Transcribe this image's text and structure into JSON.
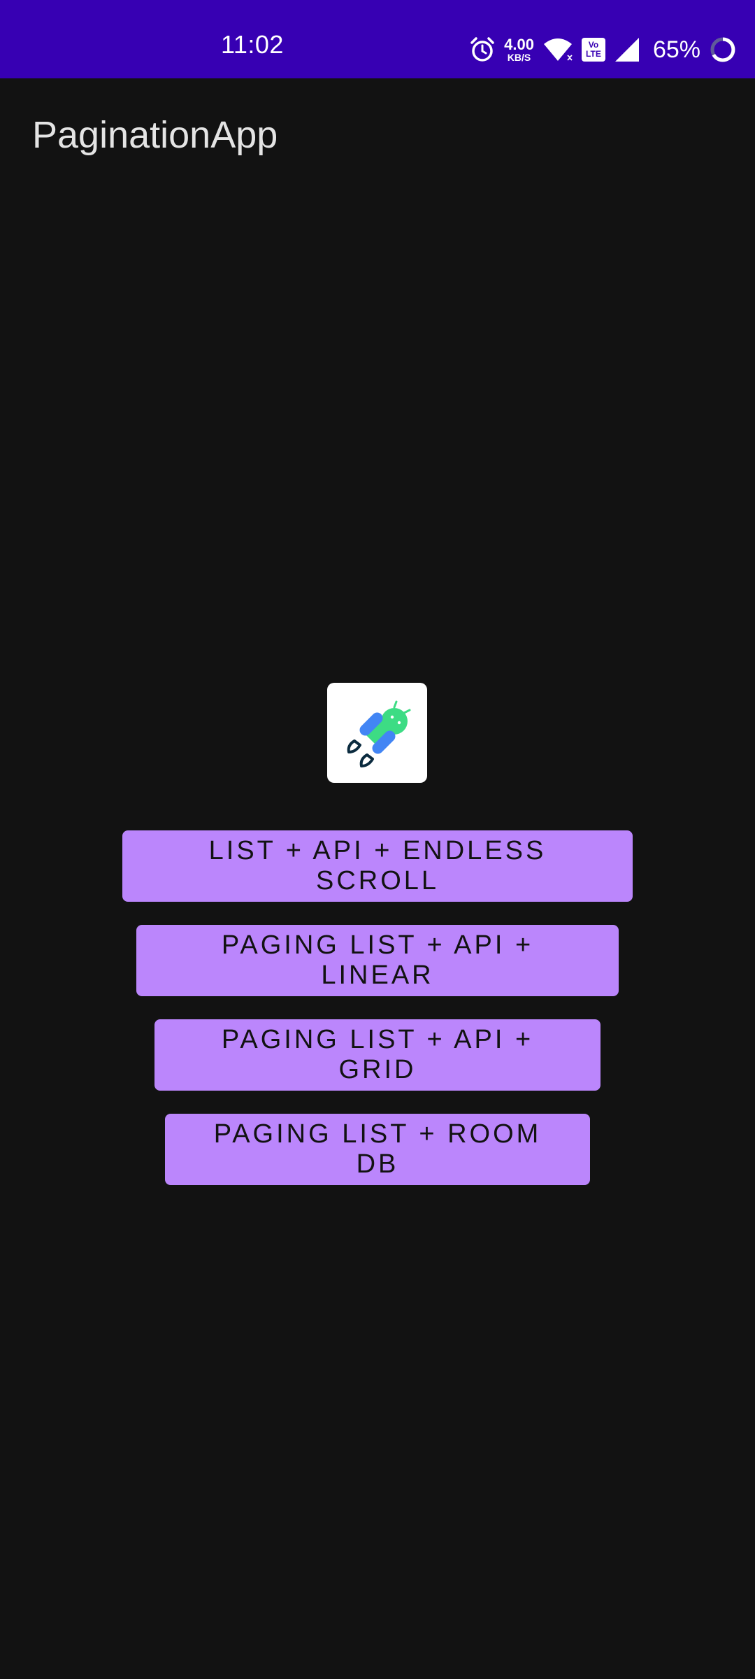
{
  "status_bar": {
    "time": "11:02",
    "speed_value": "4.00",
    "speed_unit": "KB/S",
    "volte_top": "Vo",
    "volte_bottom": "LTE",
    "battery": "65%",
    "icons": [
      "alarm-icon",
      "wifi-icon",
      "volte-icon",
      "signal-icon",
      "battery-icon"
    ]
  },
  "app_bar": {
    "title": "PaginationApp"
  },
  "logo": {
    "icon": "android-jetpack-logo"
  },
  "buttons": [
    {
      "label": "LIST + API + ENDLESS SCROLL"
    },
    {
      "label": "PAGING LIST + API + LINEAR"
    },
    {
      "label": "PAGING LIST + API + GRID"
    },
    {
      "label": "PAGING LIST + ROOM DB"
    }
  ],
  "colors": {
    "status_bar": "#3700b3",
    "background": "#121212",
    "button": "#bb86fc",
    "button_text": "#121212",
    "title_text": "#e4e4e4"
  }
}
